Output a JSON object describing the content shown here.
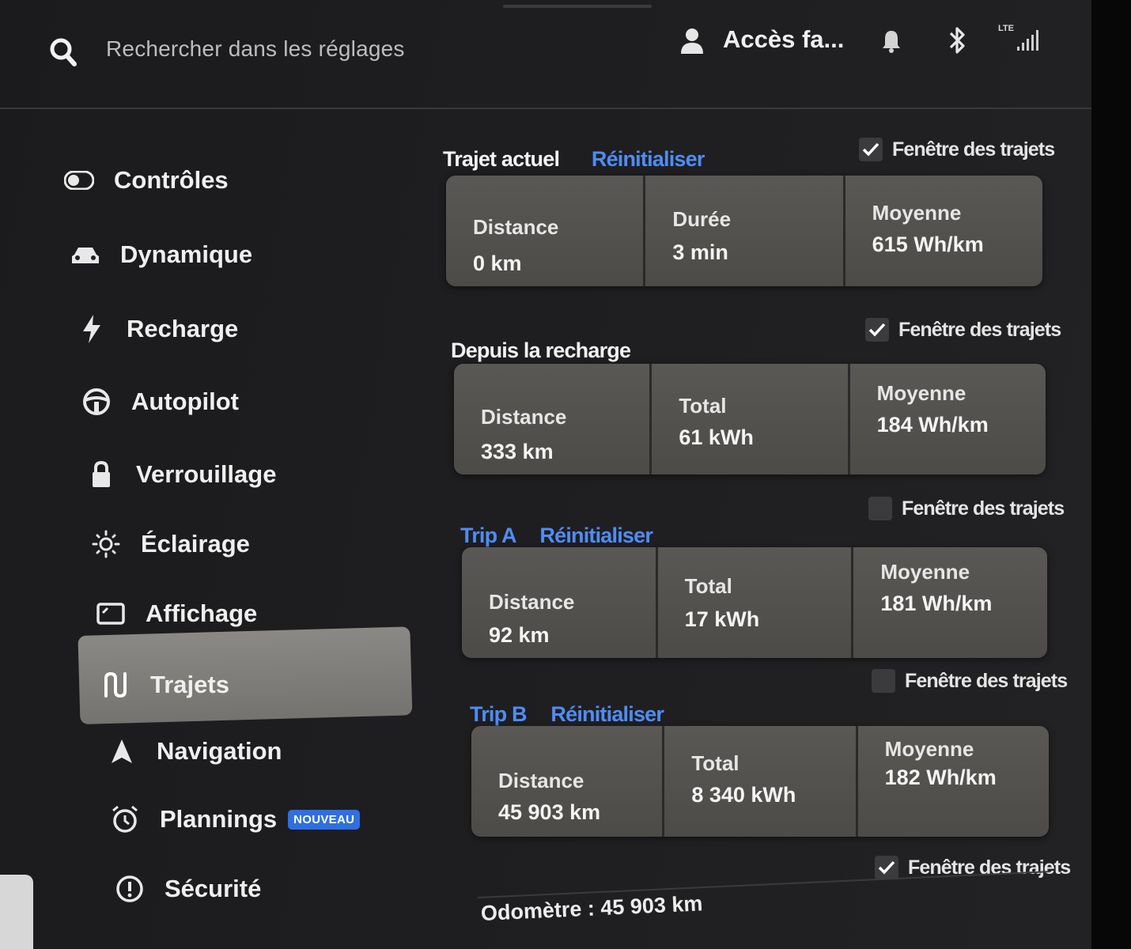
{
  "topbar": {
    "search_placeholder": "Rechercher dans les réglages",
    "profile_name": "Accès fa...",
    "network_label": "LTE",
    "icons": [
      "search-icon",
      "profile-icon",
      "bell-icon",
      "bluetooth-icon",
      "signal-icon"
    ]
  },
  "sidebar": {
    "items": [
      {
        "label": "Contrôles",
        "icon": "toggle-icon"
      },
      {
        "label": "Dynamique",
        "icon": "car-icon"
      },
      {
        "label": "Recharge",
        "icon": "bolt-icon"
      },
      {
        "label": "Autopilot",
        "icon": "steering-wheel-icon"
      },
      {
        "label": "Verrouillage",
        "icon": "lock-icon"
      },
      {
        "label": "Éclairage",
        "icon": "light-icon"
      },
      {
        "label": "Affichage",
        "icon": "display-icon"
      },
      {
        "label": "Trajets",
        "icon": "trips-icon",
        "active": true
      },
      {
        "label": "Navigation",
        "icon": "navigation-icon"
      },
      {
        "label": "Plannings",
        "icon": "alarm-clock-icon",
        "badge": "NOUVEAU"
      },
      {
        "label": "Sécurité",
        "icon": "warning-circle-icon"
      }
    ]
  },
  "sections": [
    {
      "title": "Trajet actuel",
      "reset_label": "Réinitialiser",
      "window_label": "Fenêtre des trajets",
      "window_checked": true,
      "cells": [
        {
          "label": "Distance",
          "value": "0 km"
        },
        {
          "label": "Durée",
          "value": "3 min"
        },
        {
          "label": "Moyenne",
          "value": "615 Wh/km"
        }
      ]
    },
    {
      "title": "Depuis la recharge",
      "window_label": "Fenêtre des trajets",
      "window_checked": true,
      "cells": [
        {
          "label": "Distance",
          "value": "333 km"
        },
        {
          "label": "Total",
          "value": "61 kWh"
        },
        {
          "label": "Moyenne",
          "value": "184 Wh/km"
        }
      ]
    },
    {
      "title": "Trip A",
      "reset_label": "Réinitialiser",
      "window_label": "Fenêtre des trajets",
      "window_checked": false,
      "cells": [
        {
          "label": "Distance",
          "value": "92 km"
        },
        {
          "label": "Total",
          "value": "17 kWh"
        },
        {
          "label": "Moyenne",
          "value": "181 Wh/km"
        }
      ]
    },
    {
      "title": "Trip B",
      "reset_label": "Réinitialiser",
      "window_label": "Fenêtre des trajets",
      "window_checked": false,
      "cells": [
        {
          "label": "Distance",
          "value": "45 903 km"
        },
        {
          "label": "Total",
          "value": "8 340 kWh"
        },
        {
          "label": "Moyenne",
          "value": "182 Wh/km"
        }
      ]
    }
  ],
  "odometer": {
    "label": "Odomètre : 45 903 km",
    "window_label": "Fenêtre des trajets",
    "window_checked": true
  },
  "colors": {
    "accent": "#4f8cf5",
    "badge": "#2f6fe0",
    "card": "#55534f",
    "active_item": "#807e7a"
  }
}
